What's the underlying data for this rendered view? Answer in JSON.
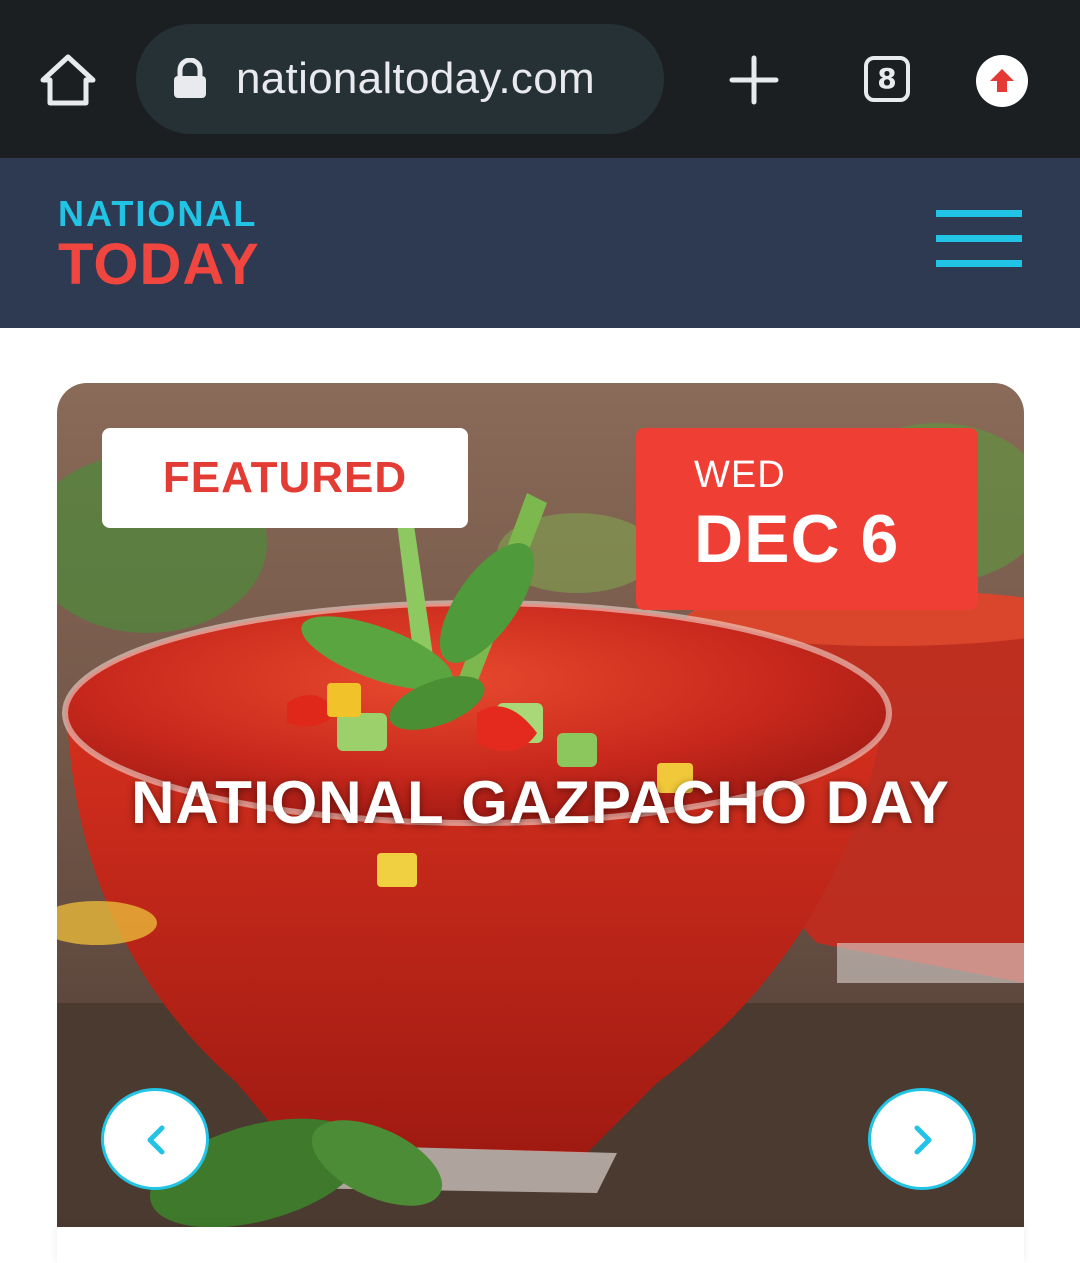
{
  "browser": {
    "url": "nationaltoday.com",
    "tab_count": "8",
    "icons": [
      "home-icon",
      "lock-icon",
      "plus-icon",
      "tabs-icon",
      "update-icon"
    ]
  },
  "site": {
    "logo_top": "NATIONAL",
    "logo_bottom": "TODAY",
    "colors": {
      "header_bg": "#2e3a52",
      "accent_cyan": "#22c4e6",
      "accent_red": "#f0463f"
    }
  },
  "featured": {
    "badge": "FEATURED",
    "day": "WED",
    "date": "DEC 6",
    "title": "NATIONAL GAZPACHO DAY",
    "prev_icon": "chevron-left-icon",
    "next_icon": "chevron-right-icon"
  }
}
